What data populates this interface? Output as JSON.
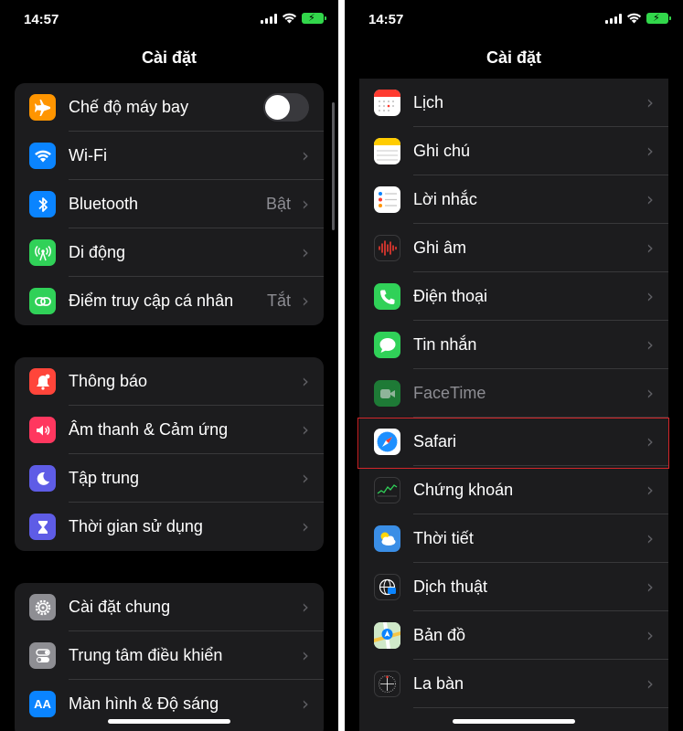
{
  "left": {
    "status": {
      "time": "14:57"
    },
    "title": "Cài đặt",
    "groups": [
      {
        "items": [
          {
            "label": "Chế độ máy bay",
            "icon": "airplane-icon"
          },
          {
            "label": "Wi-Fi",
            "icon": "wifi-icon"
          },
          {
            "label": "Bluetooth",
            "icon": "bluetooth-icon",
            "value": "Bật"
          },
          {
            "label": "Di động",
            "icon": "cellular-icon"
          },
          {
            "label": "Điểm truy cập cá nhân",
            "icon": "hotspot-icon",
            "value": "Tắt"
          }
        ]
      },
      {
        "items": [
          {
            "label": "Thông báo",
            "icon": "notifications-icon"
          },
          {
            "label": "Âm thanh & Cảm ứng",
            "icon": "sounds-icon"
          },
          {
            "label": "Tập trung",
            "icon": "focus-moon-icon"
          },
          {
            "label": "Thời gian sử dụng",
            "icon": "hourglass-icon"
          }
        ]
      },
      {
        "items": [
          {
            "label": "Cài đặt chung",
            "icon": "gear-icon"
          },
          {
            "label": "Trung tâm điều khiển",
            "icon": "control-center-icon"
          },
          {
            "label": "Màn hình & Độ sáng",
            "icon": "display-brightness-icon"
          }
        ]
      }
    ],
    "airplane_mode_on": false
  },
  "right": {
    "status": {
      "time": "14:57"
    },
    "title": "Cài đặt",
    "items": [
      {
        "label": "Lịch",
        "icon": "calendar-icon"
      },
      {
        "label": "Ghi chú",
        "icon": "notes-icon"
      },
      {
        "label": "Lời nhắc",
        "icon": "reminders-icon"
      },
      {
        "label": "Ghi âm",
        "icon": "voice-memos-icon"
      },
      {
        "label": "Điện thoại",
        "icon": "phone-icon"
      },
      {
        "label": "Tin nhắn",
        "icon": "messages-icon"
      },
      {
        "label": "FaceTime",
        "icon": "facetime-icon",
        "dimmed": true
      },
      {
        "label": "Safari",
        "icon": "safari-icon",
        "highlighted": true
      },
      {
        "label": "Chứng khoán",
        "icon": "stocks-icon"
      },
      {
        "label": "Thời tiết",
        "icon": "weather-icon"
      },
      {
        "label": "Dịch thuật",
        "icon": "translate-icon"
      },
      {
        "label": "Bản đồ",
        "icon": "maps-icon"
      },
      {
        "label": "La bàn",
        "icon": "compass-icon"
      }
    ]
  },
  "colors": {
    "highlight_border": "#d3262a",
    "toggle_off": "#39393d",
    "battery": "#32d74b"
  }
}
